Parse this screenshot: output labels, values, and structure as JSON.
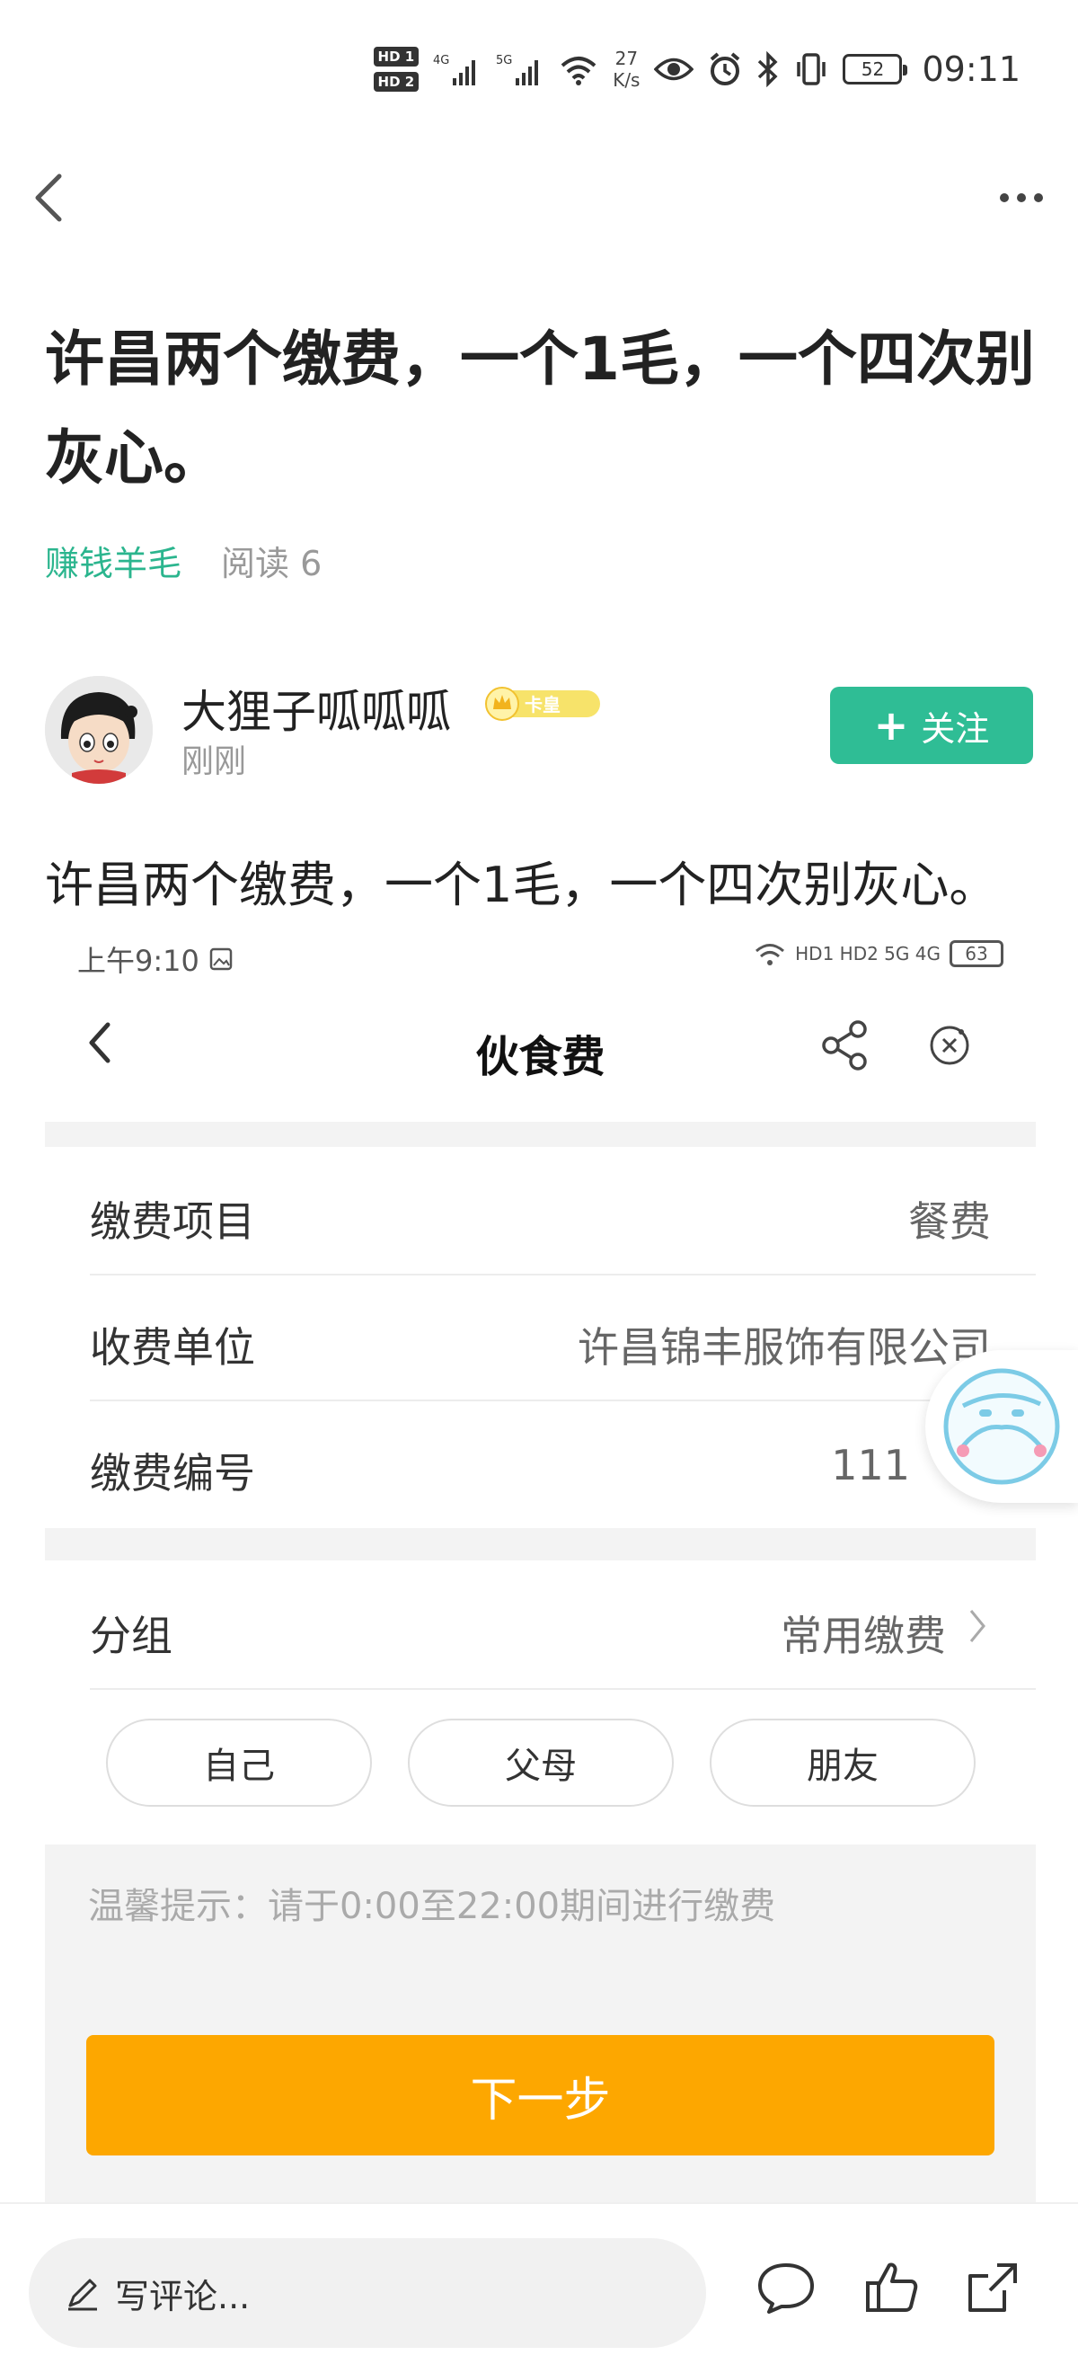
{
  "status_bar": {
    "hd1": "HD 1",
    "hd2": "HD 2",
    "net_speed_value": "27",
    "net_speed_unit": "K/s",
    "battery": "52",
    "time": "09:11"
  },
  "post": {
    "title": "许昌两个缴费，一个1毛，一个四次别灰心。",
    "category": "赚钱羊毛",
    "read_label": "阅读 6",
    "author": "大狸子呱呱呱",
    "badge_text": "卡皇",
    "time": "刚刚",
    "follow_label": "关注",
    "body": "许昌两个缴费，一个1毛，一个四次别灰心。"
  },
  "embedded": {
    "status_time": "上午9:10",
    "status_network": "HD1 HD2 5G 4G",
    "battery": "63",
    "title": "伙食费",
    "rows": [
      {
        "label": "缴费项目",
        "value": "餐费"
      },
      {
        "label": "收费单位",
        "value": "许昌锦丰服饰有限公司"
      },
      {
        "label": "缴费编号",
        "value": "111"
      }
    ],
    "group_label": "分组",
    "group_value": "常用缴费",
    "chips": [
      "自己",
      "父母",
      "朋友"
    ],
    "tip": "温馨提示：请于0:00至22:00期间进行缴费",
    "next_label": "下一步"
  },
  "bottom_bar": {
    "comment_placeholder": "写评论..."
  },
  "colors": {
    "accent_green": "#2fbd95",
    "category_green": "#2bb58e",
    "button_orange": "#fda700",
    "gray_band": "#f3f3f3"
  },
  "icons": [
    "back-arrow-icon",
    "more-dots-icon",
    "vip-crown-icon",
    "plus-icon",
    "share-icon",
    "close-circle-icon",
    "chevron-right-icon",
    "pencil-icon",
    "comment-bubble-icon",
    "thumbs-up-icon",
    "forward-icon",
    "ai-assistant-icon",
    "wifi-icon",
    "bluetooth-icon",
    "alarm-icon",
    "eye-icon",
    "vibrate-icon",
    "signal-icon",
    "gallery-icon"
  ]
}
